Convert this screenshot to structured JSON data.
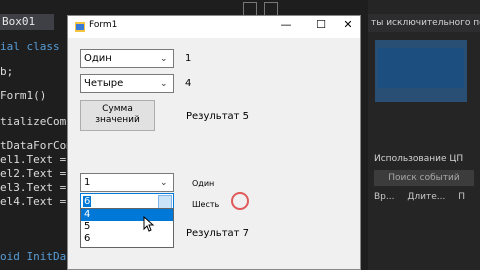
{
  "ide": {
    "tab_title": "Box01",
    "code_lines": [
      {
        "text": "ial class For"
      },
      {
        "text": "b;"
      },
      {
        "text": "Form1()"
      },
      {
        "text": "tializeCompo"
      },
      {
        "text": "tDataForCombo"
      },
      {
        "text": "el1.Text = \""
      },
      {
        "text": "el2.Text = \""
      },
      {
        "text": "el3.Text = \""
      },
      {
        "text": "el4.Text = \""
      },
      {
        "text": "oid InitData"
      }
    ],
    "right_header": "ты исключительного пользова",
    "cpu_label": "Использование ЦП",
    "search_events": "Поиск событий",
    "columns": [
      "Вр...",
      "Длите...",
      "П"
    ]
  },
  "form": {
    "title": "Form1",
    "minimize": "—",
    "maximize": "☐",
    "close": "✕",
    "combo1": {
      "value": "Один"
    },
    "label1": "1",
    "combo2": {
      "value": "Четыре"
    },
    "label2": "4",
    "sum_button": {
      "line1": "Сумма",
      "line2": "значений"
    },
    "result1": "Результат 5",
    "combo3": {
      "value": "1"
    },
    "label3": "Один",
    "combo4": {
      "value": "6"
    },
    "label4": "Шесть",
    "dropdown_options": [
      "4",
      "5",
      "6"
    ],
    "result2": "Результат 7"
  }
}
